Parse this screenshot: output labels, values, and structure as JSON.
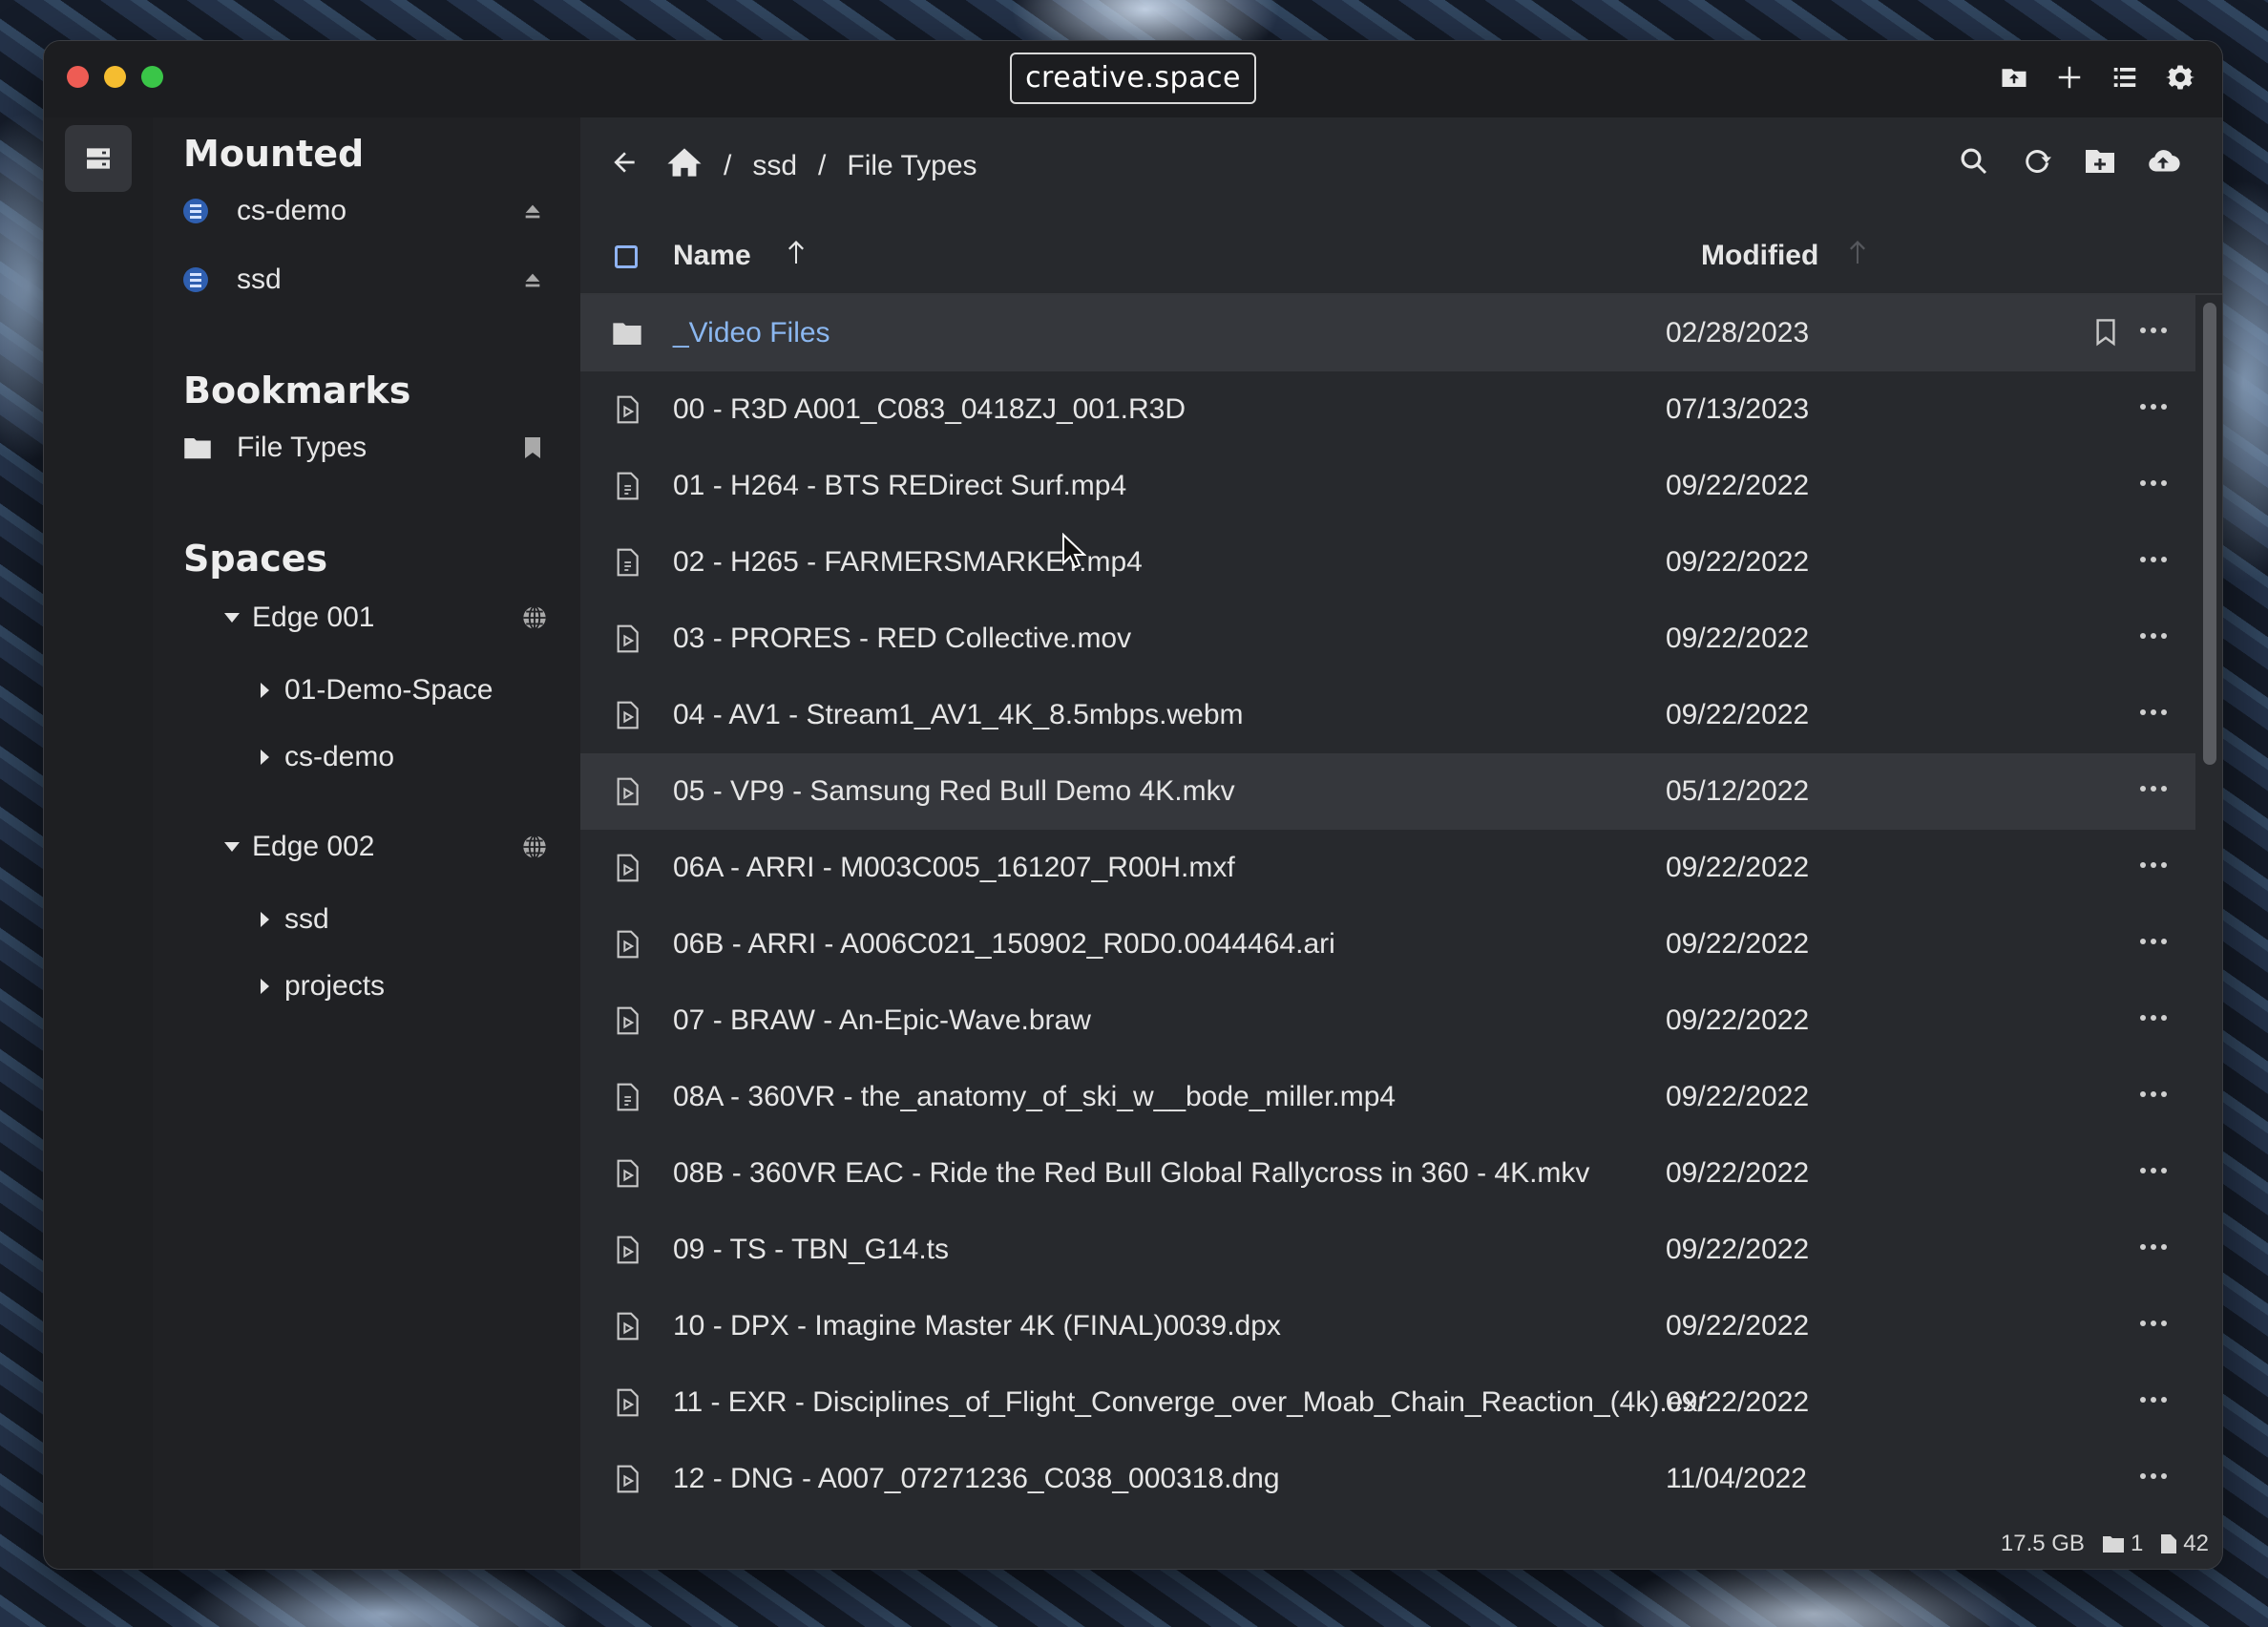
{
  "window": {
    "title": "creative.space"
  },
  "sidebar": {
    "mounted_heading": "Mounted",
    "mounted": [
      {
        "label": "cs-demo"
      },
      {
        "label": "ssd"
      }
    ],
    "bookmarks_heading": "Bookmarks",
    "bookmarks": [
      {
        "label": "File Types"
      }
    ],
    "spaces_heading": "Spaces",
    "spaces": [
      {
        "label": "Edge 001",
        "children": [
          "01-Demo-Space",
          "cs-demo"
        ]
      },
      {
        "label": "Edge 002",
        "children": [
          "ssd",
          "projects"
        ]
      }
    ]
  },
  "breadcrumb": {
    "parts": [
      "ssd",
      "File Types"
    ],
    "separator": "/"
  },
  "columns": {
    "name": "Name",
    "modified": "Modified"
  },
  "files": [
    {
      "name": "_Video Files",
      "date": "02/28/2023",
      "type": "folder"
    },
    {
      "name": "00 - R3D A001_C083_0418ZJ_001.R3D",
      "date": "07/13/2023",
      "type": "video"
    },
    {
      "name": "01 - H264 - BTS REDirect Surf.mp4",
      "date": "09/22/2022",
      "type": "file"
    },
    {
      "name": "02 - H265 - FARMERSMARKET.mp4",
      "date": "09/22/2022",
      "type": "file"
    },
    {
      "name": "03 - PRORES - RED Collective.mov",
      "date": "09/22/2022",
      "type": "video"
    },
    {
      "name": "04 - AV1 - Stream1_AV1_4K_8.5mbps.webm",
      "date": "09/22/2022",
      "type": "video"
    },
    {
      "name": "05 - VP9 - Samsung Red Bull Demo 4K.mkv",
      "date": "05/12/2022",
      "type": "video"
    },
    {
      "name": "06A - ARRI - M003C005_161207_R00H.mxf",
      "date": "09/22/2022",
      "type": "video"
    },
    {
      "name": "06B - ARRI - A006C021_150902_R0D0.0044464.ari",
      "date": "09/22/2022",
      "type": "video"
    },
    {
      "name": "07 - BRAW - An-Epic-Wave.braw",
      "date": "09/22/2022",
      "type": "video"
    },
    {
      "name": "08A - 360VR - the_anatomy_of_ski_w__bode_miller.mp4",
      "date": "09/22/2022",
      "type": "file"
    },
    {
      "name": "08B - 360VR EAC - Ride the Red Bull Global Rallycross in 360 - 4K.mkv",
      "date": "09/22/2022",
      "type": "video"
    },
    {
      "name": "09 - TS - TBN_G14.ts",
      "date": "09/22/2022",
      "type": "video"
    },
    {
      "name": "10 - DPX - Imagine Master 4K (FINAL)0039.dpx",
      "date": "09/22/2022",
      "type": "video"
    },
    {
      "name": "11 - EXR - Disciplines_of_Flight_Converge_over_Moab_Chain_Reaction_(4k).exr",
      "date": "09/22/2022",
      "type": "video"
    },
    {
      "name": "12 - DNG - A007_07271236_C038_000318.dng",
      "date": "11/04/2022",
      "type": "video"
    }
  ],
  "status": {
    "size": "17.5 GB",
    "folders": "1",
    "files": "42"
  },
  "colors": {
    "accent": "#8bb7f0",
    "window_bg": "#27292d",
    "sidebar_bg": "#202124",
    "titlebar_bg": "#1c1d20"
  }
}
